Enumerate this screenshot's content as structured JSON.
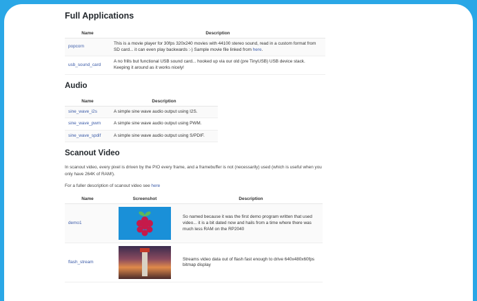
{
  "sections": {
    "full_apps": {
      "title": "Full Applications",
      "headers": {
        "name": "Name",
        "description": "Description"
      },
      "rows": [
        {
          "name": "popcorn",
          "description_pre": "This is a movie player for 30fps 320x240 movies with 44100 stereo sound, read in a custom format from SD card... it can even play backwards :-) Sample movie file linked from ",
          "link": "here",
          "description_post": "."
        },
        {
          "name": "usb_sound_card",
          "description": "A no frills but functional USB sound card... hooked up via our old (pre TinyUSB) USB device stack. Keeping it around as it works nicely!"
        }
      ]
    },
    "audio": {
      "title": "Audio",
      "headers": {
        "name": "Name",
        "description": "Description"
      },
      "rows": [
        {
          "name": "sine_wave_i2s",
          "description": "A simple sine wave audio output using I2S."
        },
        {
          "name": "sine_wave_pwm",
          "description": "A simple sine wave audio output using PWM."
        },
        {
          "name": "sine_wave_spdif",
          "description": "A simple sine wave audio output using S/PDIF."
        }
      ]
    },
    "scanout": {
      "title": "Scanout Video",
      "intro": "In scanout video, every pixel is driven by the PIO every frame, and a framebuffer is not (necessarily) used (which is useful when you only have 264K of RAM!).",
      "fuller_pre": "For a fuller description of scanout video see ",
      "fuller_link": "here",
      "headers": {
        "name": "Name",
        "screenshot": "Screenshot",
        "description": "Description"
      },
      "rows": [
        {
          "name": "demo1",
          "screenshot_icon": "raspberry-pi-logo",
          "description": "So named because it was the first demo program written that used video... it is a bit dated now and hails from a time where there was much less RAM on the RP2040"
        },
        {
          "name": "flash_stream",
          "screenshot_icon": "lighthouse-photo",
          "description": "Streams video data out of flash fast enough to drive 640x480x60fps bitmap display"
        }
      ]
    }
  },
  "colors": {
    "background": "#2aa7e6",
    "link": "#3b5ba8",
    "card": "#ffffff"
  }
}
